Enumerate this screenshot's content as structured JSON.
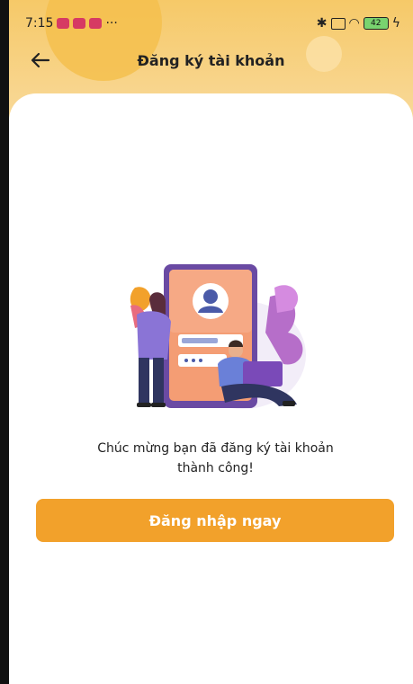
{
  "status_bar": {
    "time": "7:15",
    "dots": "···",
    "battery": "42"
  },
  "header": {
    "title": "Đăng ký tài khoản"
  },
  "main": {
    "success_line1": "Chúc mừng bạn đã đăng ký tài khoản",
    "success_line2": "thành công!",
    "login_button_label": "Đăng nhập ngay"
  },
  "colors": {
    "accent": "#f2a12b",
    "header": "#f6c968"
  }
}
